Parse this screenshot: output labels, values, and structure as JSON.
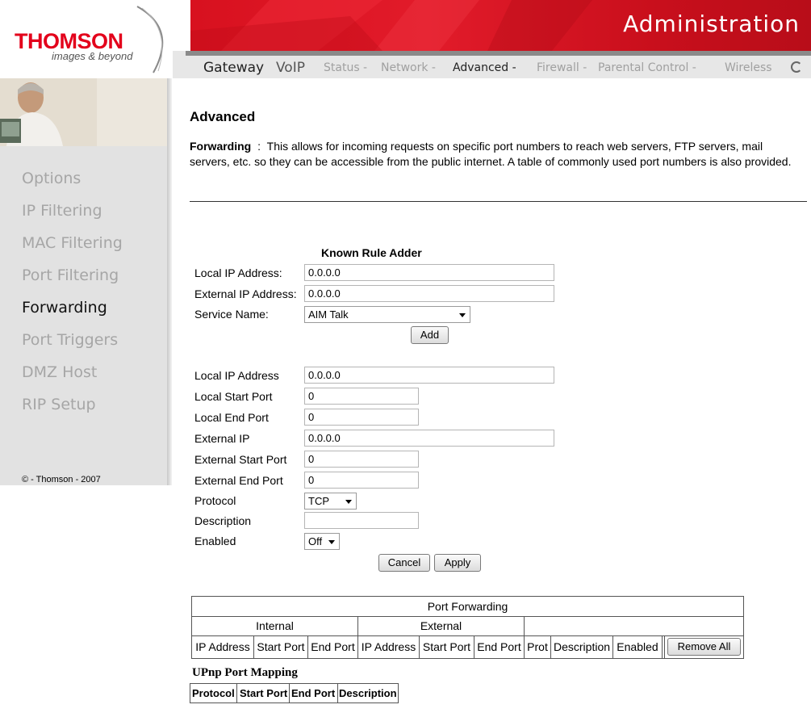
{
  "header": {
    "logo": "THOMSON",
    "tagline": "images & beyond",
    "title": "Administration"
  },
  "nav": {
    "gateway": "Gateway",
    "voip": "VoIP",
    "status": "Status -",
    "network": "Network -",
    "advanced": "Advanced -",
    "firewall": "Firewall -",
    "parental": "Parental Control -",
    "wireless": "Wireless"
  },
  "sidebar": {
    "items": [
      {
        "label": "Options"
      },
      {
        "label": "IP Filtering"
      },
      {
        "label": "MAC Filtering"
      },
      {
        "label": "Port Filtering"
      },
      {
        "label": "Forwarding"
      },
      {
        "label": "Port Triggers"
      },
      {
        "label": "DMZ Host"
      },
      {
        "label": "RIP Setup"
      }
    ],
    "active": "Forwarding",
    "copyright": "© - Thomson - 2007"
  },
  "main": {
    "title": "Advanced",
    "desc_heading": "Forwarding",
    "desc_sep": ":",
    "desc_text": "This allows for incoming requests on specific port numbers to reach web servers, FTP servers, mail servers, etc. so they can be accessible from the public internet. A table of commonly used port numbers is also provided."
  },
  "known_rule": {
    "title": "Known Rule Adder",
    "local_ip_label": "Local IP Address:",
    "local_ip_value": "0.0.0.0",
    "external_ip_label": "External IP Address:",
    "external_ip_value": "0.0.0.0",
    "service_label": "Service Name:",
    "service_value": "AIM Talk",
    "add_label": "Add"
  },
  "rule_form": {
    "local_ip_label": "Local IP Address",
    "local_ip_value": "0.0.0.0",
    "local_start_label": "Local Start Port",
    "local_start_value": "0",
    "local_end_label": "Local End Port",
    "local_end_value": "0",
    "external_ip_label": "External IP",
    "external_ip_value": "0.0.0.0",
    "external_start_label": "External Start Port",
    "external_start_value": "0",
    "external_end_label": "External End Port",
    "external_end_value": "0",
    "protocol_label": "Protocol",
    "protocol_value": "TCP",
    "description_label": "Description",
    "description_value": "",
    "enabled_label": "Enabled",
    "enabled_value": "Off",
    "cancel_label": "Cancel",
    "apply_label": "Apply"
  },
  "port_forwarding": {
    "title": "Port Forwarding",
    "internal": "Internal",
    "external": "External",
    "columns": [
      "IP Address",
      "Start Port",
      "End Port",
      "IP Address",
      "Start Port",
      "End Port",
      "Prot",
      "Description",
      "Enabled"
    ],
    "remove_all_label": "Remove All"
  },
  "upnp": {
    "title": "UPnp Port Mapping",
    "columns": [
      "Protocol",
      "Start Port",
      "End Port",
      "Description"
    ]
  },
  "colors": {
    "brand_red": "#e3001b",
    "sidebar_bg": "#e2e2e2",
    "inactive_text": "#a6a6a6"
  }
}
